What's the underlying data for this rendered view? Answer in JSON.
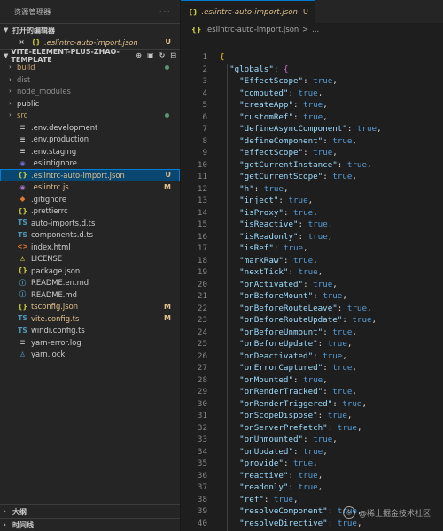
{
  "explorer": {
    "title": "资源管理器",
    "more": "···",
    "open_editors": {
      "header": "打开的编辑器",
      "items": [
        {
          "close": "×",
          "icon": "{}",
          "name": ".eslintrc-auto-import.json",
          "status": "U"
        }
      ]
    },
    "project": {
      "header": "VITE-ELEMENT-PLUS-ZHAO-TEMPLATE",
      "items": [
        {
          "kind": "folder",
          "name": "build",
          "color": "#c9a26d",
          "marker": "dot"
        },
        {
          "kind": "folder",
          "name": "dist",
          "color": "#8c8c8c"
        },
        {
          "kind": "folder",
          "name": "node_modules",
          "color": "#8c8c8c"
        },
        {
          "kind": "folder",
          "name": "public",
          "color": "#cccccc"
        },
        {
          "kind": "folder",
          "name": "src",
          "color": "#c9a26d",
          "marker": "dot"
        },
        {
          "kind": "file",
          "icon": "≡",
          "iconColor": "#cccccc",
          "name": ".env.development",
          "color": "#cccccc"
        },
        {
          "kind": "file",
          "icon": "≡",
          "iconColor": "#cccccc",
          "name": ".env.production",
          "color": "#cccccc"
        },
        {
          "kind": "file",
          "icon": "≡",
          "iconColor": "#cccccc",
          "name": ".env.staging",
          "color": "#cccccc"
        },
        {
          "kind": "file",
          "icon": "◉",
          "iconColor": "#6c6cd0",
          "name": ".eslintignore",
          "color": "#cccccc"
        },
        {
          "kind": "file",
          "icon": "{}",
          "iconColor": "#cbcb41",
          "name": ".eslintrc-auto-import.json",
          "color": "#e2c08d",
          "status": "U",
          "selected": true
        },
        {
          "kind": "file",
          "icon": "◉",
          "iconColor": "#a074c4",
          "name": ".eslintrc.js",
          "color": "#e2c08d",
          "status": "M"
        },
        {
          "kind": "file",
          "icon": "◆",
          "iconColor": "#e37933",
          "name": ".gitignore",
          "color": "#cccccc"
        },
        {
          "kind": "file",
          "icon": "{}",
          "iconColor": "#cbcb41",
          "name": ".prettierrc",
          "color": "#cccccc"
        },
        {
          "kind": "file",
          "icon": "TS",
          "iconColor": "#519aba",
          "name": "auto-imports.d.ts",
          "color": "#cccccc"
        },
        {
          "kind": "file",
          "icon": "TS",
          "iconColor": "#519aba",
          "name": "components.d.ts",
          "color": "#cccccc"
        },
        {
          "kind": "file",
          "icon": "<>",
          "iconColor": "#e37933",
          "name": "index.html",
          "color": "#cccccc"
        },
        {
          "kind": "file",
          "icon": "♙",
          "iconColor": "#cbcb41",
          "name": "LICENSE",
          "color": "#cccccc"
        },
        {
          "kind": "file",
          "icon": "{}",
          "iconColor": "#cbcb41",
          "name": "package.json",
          "color": "#cccccc"
        },
        {
          "kind": "file",
          "icon": "ⓘ",
          "iconColor": "#519aba",
          "name": "README.en.md",
          "color": "#cccccc"
        },
        {
          "kind": "file",
          "icon": "ⓘ",
          "iconColor": "#519aba",
          "name": "README.md",
          "color": "#cccccc"
        },
        {
          "kind": "file",
          "icon": "{}",
          "iconColor": "#cbcb41",
          "name": "tsconfig.json",
          "color": "#e2c08d",
          "status": "M"
        },
        {
          "kind": "file",
          "icon": "TS",
          "iconColor": "#519aba",
          "name": "vite.config.ts",
          "color": "#e2c08d",
          "status": "M"
        },
        {
          "kind": "file",
          "icon": "TS",
          "iconColor": "#519aba",
          "name": "windi.config.ts",
          "color": "#cccccc"
        },
        {
          "kind": "file",
          "icon": "≡",
          "iconColor": "#cccccc",
          "name": "yarn-error.log",
          "color": "#cccccc"
        },
        {
          "kind": "file",
          "icon": "♙",
          "iconColor": "#519aba",
          "name": "yarn.lock",
          "color": "#cccccc"
        }
      ]
    },
    "outline": {
      "header": "大纲"
    },
    "timeline": {
      "header": "时间线"
    }
  },
  "editor": {
    "tab": {
      "icon": "{}",
      "name": ".eslintrc-auto-import.json",
      "status": "U"
    },
    "breadcrumb": {
      "icon": "{}",
      "file": ".eslintrc-auto-import.json",
      "sep": ">",
      "rest": "..."
    },
    "globals_key": "\"globals\"",
    "entries": [
      "EffectScope",
      "computed",
      "createApp",
      "customRef",
      "defineAsyncComponent",
      "defineComponent",
      "effectScope",
      "getCurrentInstance",
      "getCurrentScope",
      "h",
      "inject",
      "isProxy",
      "isReactive",
      "isReadonly",
      "isRef",
      "markRaw",
      "nextTick",
      "onActivated",
      "onBeforeMount",
      "onBeforeRouteLeave",
      "onBeforeRouteUpdate",
      "onBeforeUnmount",
      "onBeforeUpdate",
      "onDeactivated",
      "onErrorCaptured",
      "onMounted",
      "onRenderTracked",
      "onRenderTriggered",
      "onScopeDispose",
      "onServerPrefetch",
      "onUnmounted",
      "onUpdated",
      "provide",
      "reactive",
      "readonly",
      "ref",
      "resolveComponent",
      "resolveDirective"
    ],
    "value_literal": "true",
    "first_line_number": 1
  },
  "watermark": {
    "text": "@稀土掘金技术社区"
  }
}
